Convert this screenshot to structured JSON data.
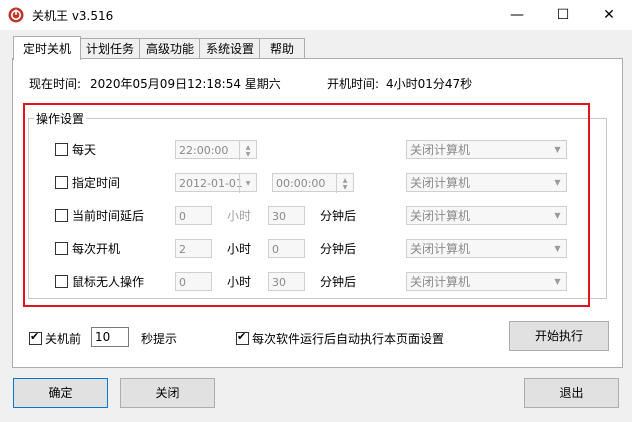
{
  "window": {
    "title": "关机王 v3.516",
    "minimize": "—",
    "maximize": "☐",
    "close": "✕"
  },
  "tabs": [
    "定时关机",
    "计划任务",
    "高级功能",
    "系统设置",
    "帮助"
  ],
  "info": {
    "now_label": "现在时间:",
    "now_value": "2020年05月09日12:18:54 星期六",
    "uptime_label": "开机时间:",
    "uptime_value": "4小时01分47秒"
  },
  "group_title": "操作设置",
  "rows": [
    {
      "label": "每天",
      "checked": false,
      "time": "22:00:00",
      "action": "关闭计算机"
    },
    {
      "label": "指定时间",
      "checked": false,
      "date": "2012-01-01",
      "time": "00:00:00",
      "action": "关闭计算机"
    },
    {
      "label": "当前时间延后",
      "checked": false,
      "hours": "0",
      "hours_unit": "小时",
      "minutes": "30",
      "minutes_unit": "分钟后",
      "action": "关闭计算机"
    },
    {
      "label": "每次开机",
      "checked": false,
      "hours": "2",
      "hours_unit": "小时",
      "minutes": "0",
      "minutes_unit": "分钟后",
      "action": "关闭计算机"
    },
    {
      "label": "鼠标无人操作",
      "checked": false,
      "hours": "0",
      "hours_unit": "小时",
      "minutes": "30",
      "minutes_unit": "分钟后",
      "action": "关闭计算机"
    }
  ],
  "footer": {
    "before_label": "关机前",
    "before_value": "10",
    "before_suffix": "秒提示",
    "before_checked": true,
    "auto_label": "每次软件运行后自动执行本页面设置",
    "auto_checked": true,
    "start_button": "开始执行"
  },
  "buttons": {
    "ok": "确定",
    "close": "关闭",
    "exit": "退出"
  }
}
